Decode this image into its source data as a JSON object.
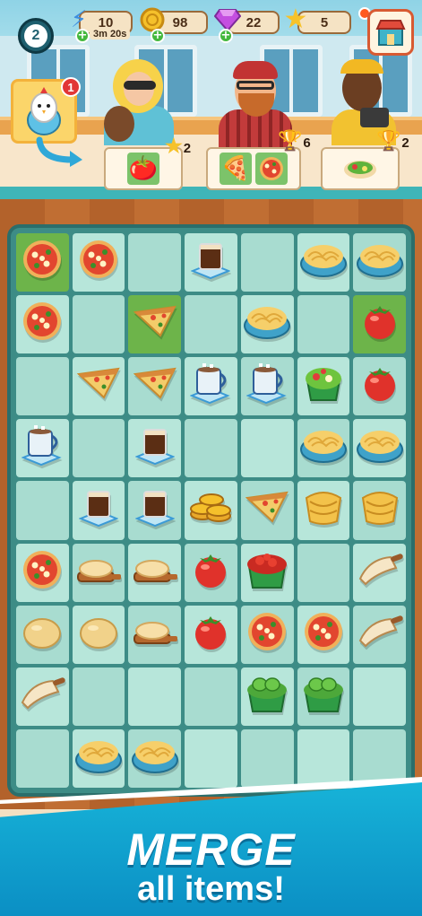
{
  "hud": {
    "level": "2",
    "energy": "10",
    "energy_timer": "3m 20s",
    "coins": "98",
    "gems": "22",
    "stars": "5"
  },
  "icons": {
    "energy": "lightning-icon",
    "coins": "coin-icon",
    "gems": "gem-icon",
    "stars": "star-icon",
    "shop": "shop-icon",
    "generator": "chicken-egg-icon"
  },
  "generator": {
    "badge": "1"
  },
  "orders": [
    {
      "items": [
        "tomato"
      ],
      "reward": "2",
      "reward_icon": "star-icon"
    },
    {
      "items": [
        "pizza-slice",
        "pizza"
      ],
      "reward": "6",
      "reward_icon": "trophy-icon"
    },
    {
      "items": [
        "salad"
      ],
      "reward": "2",
      "reward_icon": "trophy-icon"
    }
  ],
  "board": {
    "rows": [
      [
        "pizza",
        "pizza",
        "",
        "coffee-glass",
        "",
        "pasta-bowl",
        "pasta-bowl"
      ],
      [
        "pizza",
        "",
        "pizza-slice",
        "",
        "pasta-bowl",
        "",
        "tomato"
      ],
      [
        "",
        "pizza-slice",
        "pizza-slice",
        "coffee-mug",
        "coffee-mug",
        "salad",
        "tomato"
      ],
      [
        "coffee-mug",
        "",
        "coffee-glass",
        "",
        "",
        "pasta-bowl",
        "pasta-bowl"
      ],
      [
        "",
        "coffee-glass",
        "coffee-glass",
        "coins",
        "pizza-slice",
        "raw-pasta",
        "raw-pasta"
      ],
      [
        "pizza",
        "dough-board",
        "dough-board",
        "tomato",
        "tomato-bowl",
        "",
        "flour-scoop"
      ],
      [
        "dough",
        "dough",
        "dough-board",
        "tomato",
        "pizza",
        "pizza",
        "flour-scoop"
      ],
      [
        "flour-scoop",
        "",
        "",
        "",
        "pepper-bowl",
        "pepper-bowl",
        ""
      ],
      [
        "",
        "pasta-bowl",
        "pasta-bowl",
        "",
        "",
        "",
        ""
      ]
    ],
    "highlighted": [
      [
        0,
        0
      ],
      [
        1,
        2
      ],
      [
        1,
        6
      ]
    ]
  },
  "banner": {
    "title": "MERGE",
    "subtitle": "all items!"
  }
}
